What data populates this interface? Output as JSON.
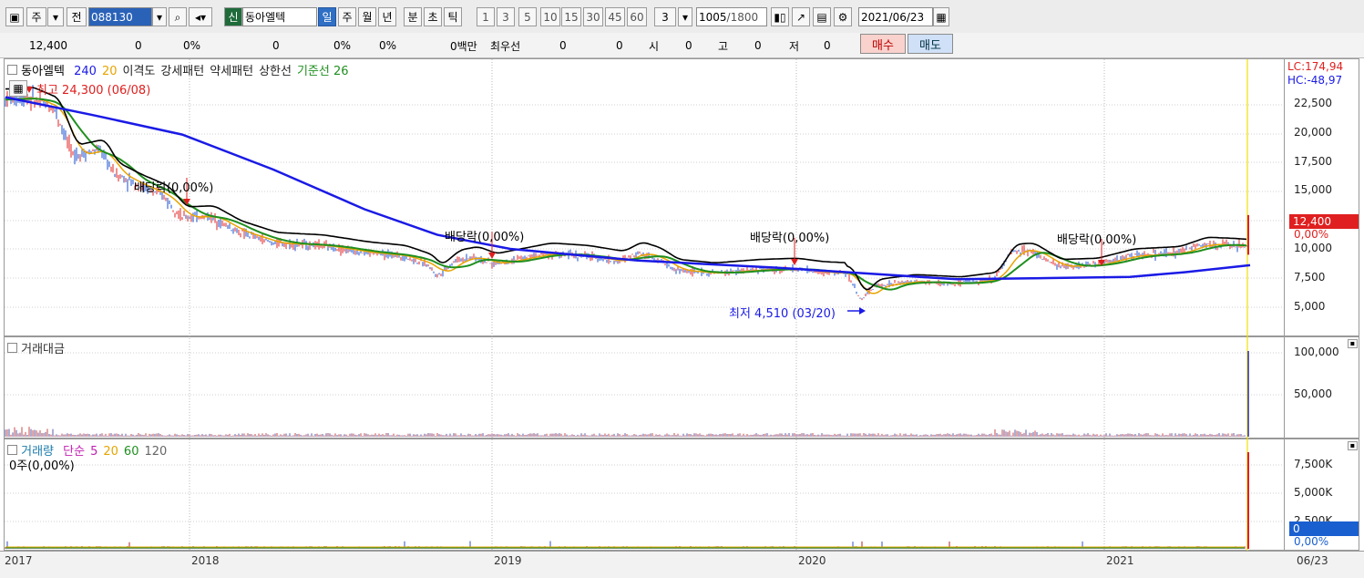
{
  "toolbar": {
    "mode": "주",
    "prev_label": "전",
    "code": "088130",
    "market_badge": "신",
    "stock_name": "동아엘텍",
    "periods": [
      "일",
      "주",
      "월",
      "년",
      "분",
      "초",
      "틱"
    ],
    "selected_period": "일",
    "intervals": [
      "1",
      "3",
      "5",
      "10",
      "15",
      "30",
      "45",
      "60"
    ],
    "interval_value": "3",
    "count_display": "1005",
    "count_total": "/1800",
    "date": "2021/06/23"
  },
  "quote": {
    "price": "12,400",
    "change": "0",
    "change_pct": "0%",
    "volume": "0",
    "volume_pct": "0%",
    "turnover_pct": "0%",
    "amount": "0백만",
    "best_ask_label": "최우선",
    "best_ask": "0",
    "best_bid": "0",
    "open_label": "시",
    "open": "0",
    "high_label": "고",
    "high": "0",
    "low_label": "저",
    "low": "0",
    "buy_label": "매수",
    "sell_label": "매도"
  },
  "colors": {
    "ma240": "#1a1ae6",
    "ma20": "#e8a400",
    "trend": "#1f8f1f",
    "black": "#000000",
    "red": "#e02020",
    "buy_bg": "#f9d2cd",
    "sell_bg": "#cfe0f7"
  },
  "price_panel": {
    "legend_name": "동아엘텍",
    "legend_items": [
      {
        "text": "240",
        "color": "#1a1ae6"
      },
      {
        "text": "20",
        "color": "#e8a400"
      },
      {
        "text": "이격도",
        "color": "#222"
      },
      {
        "text": "강세패턴",
        "color": "#222"
      },
      {
        "text": "약세패턴",
        "color": "#222"
      },
      {
        "text": "상한선",
        "color": "#222"
      },
      {
        "text": "기준선 26",
        "color": "#1f8f1f"
      }
    ],
    "high_label": "최고 24,300 (06/08)",
    "low_label": "최저 4,510 (03/20)",
    "dividend_label": "배당락(0,00%)",
    "lc_label": "LC:174,94",
    "hc_label": "HC:-48,97",
    "last_price_tag": "12,400",
    "last_pct_tag": "0,00%",
    "y_ticks": [
      "22,500",
      "20,000",
      "17,500",
      "15,000",
      "12,500",
      "10,000",
      "7,500",
      "5,000"
    ]
  },
  "amount_panel": {
    "legend": "거래대금",
    "y_ticks": [
      "100,000",
      "50,000"
    ]
  },
  "volume_panel": {
    "legend_name": "거래량",
    "legend_items": [
      {
        "text": "단순",
        "color": "#c01fb0"
      },
      {
        "text": "5",
        "color": "#c01fb0"
      },
      {
        "text": "20",
        "color": "#e8a400"
      },
      {
        "text": "60",
        "color": "#1f8f1f"
      },
      {
        "text": "120",
        "color": "#666"
      }
    ],
    "value_label": "0주(0,00%)",
    "y_ticks": [
      "7,500K",
      "5,000K",
      "2,500K"
    ],
    "last_tag": "0",
    "last_pct_tag": "0,00%"
  },
  "x_axis": {
    "labels": [
      "2017",
      "2018",
      "2019",
      "2020",
      "2021"
    ],
    "last_date": "06/23"
  }
}
